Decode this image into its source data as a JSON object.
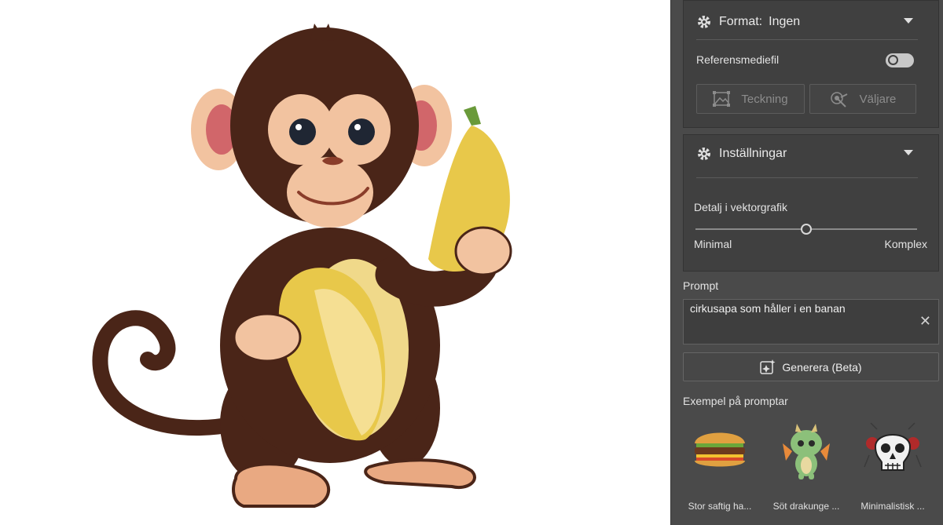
{
  "format_section": {
    "label": "Format:",
    "value": "Ingen",
    "reference_label": "Referensmediefil",
    "reference_enabled": false,
    "drawing_button": "Teckning",
    "picker_button": "Väljare"
  },
  "settings_section": {
    "title": "Inställningar",
    "detail_label": "Detalj i vektorgrafik",
    "slider_min_label": "Minimal",
    "slider_max_label": "Komplex",
    "detail_value": 0.5
  },
  "prompt": {
    "label": "Prompt",
    "value": "cirkusapa som håller i en banan"
  },
  "generate_button": "Generera (Beta)",
  "examples": {
    "title": "Exempel på promptar",
    "items": [
      {
        "caption": "Stor saftig ha...",
        "icon": "burger-icon"
      },
      {
        "caption": "Söt drakunge ...",
        "icon": "dragon-icon"
      },
      {
        "caption": "Minimalistisk ...",
        "icon": "skull-icon"
      }
    ]
  },
  "canvas_image": "monkey-holding-banana-vector"
}
